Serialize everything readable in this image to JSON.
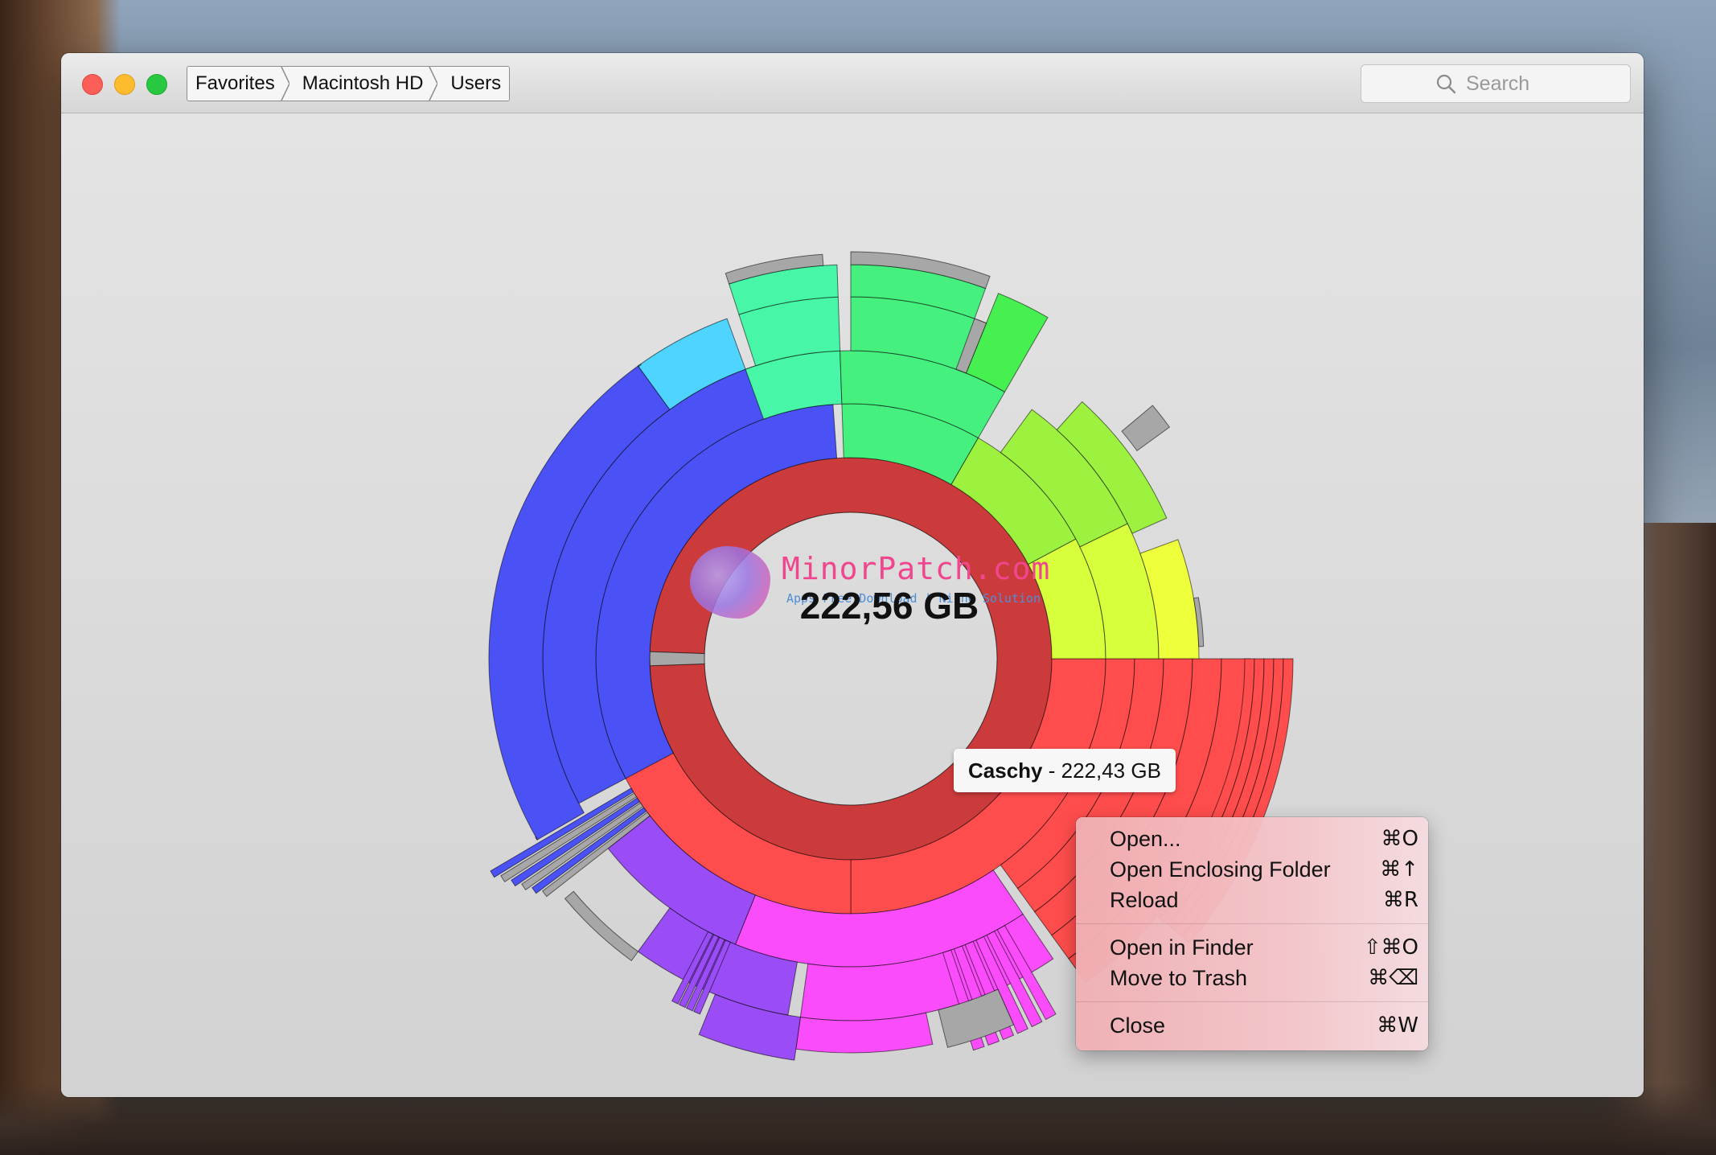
{
  "window": {
    "breadcrumb": [
      "Favorites",
      "Macintosh HD",
      "Users"
    ],
    "search": {
      "placeholder": "Search"
    }
  },
  "sunburst": {
    "total_size": "222,56 GB",
    "tooltip": {
      "name": "Caschy",
      "size": "- 222,43 GB"
    }
  },
  "watermark": {
    "title": "MinorPatch.com",
    "subtitle": "Apps Free Download | Niche Solution"
  },
  "context_menu": {
    "groups": [
      [
        {
          "label": "Open...",
          "shortcut": "⌘O"
        },
        {
          "label": "Open Enclosing Folder",
          "shortcut": "⌘↑"
        },
        {
          "label": "Reload",
          "shortcut": "⌘R"
        }
      ],
      [
        {
          "label": "Open in Finder",
          "shortcut": "⇧⌘O"
        },
        {
          "label": "Move to Trash",
          "shortcut": "⌘⌫"
        }
      ],
      [
        {
          "label": "Close",
          "shortcut": "⌘W"
        }
      ]
    ]
  },
  "colors": {
    "inner_ring": "#cc3b3b",
    "red": "#ff4d4d",
    "blue": "#4b52f5",
    "cyan": "#4ed4ff",
    "teal": "#47f7a7",
    "green": "#45f07e",
    "lime": "#9cf23e",
    "yellow": "#d8ff3c",
    "purple": "#9a4cf7",
    "magenta": "#fa4cfa",
    "gray": "#a7a7a7"
  }
}
